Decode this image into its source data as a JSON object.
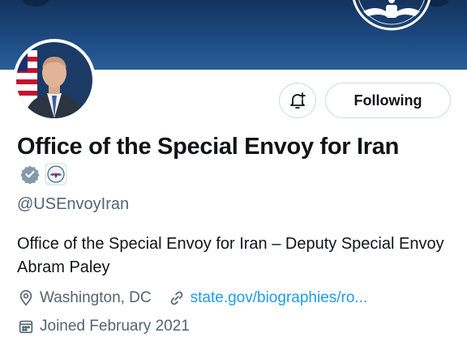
{
  "profile": {
    "display_name": "Office of the Special Envoy for Iran",
    "handle": "@USEnvoyIran",
    "bio": "Office of the Special Envoy for Iran – Deputy Special Envoy Abram Paley",
    "location": "Washington, DC",
    "website": "state.gov/biographies/ro...",
    "joined": "Joined February 2021"
  },
  "actions": {
    "follow_label": "Following"
  },
  "icons": {
    "verified": "verified-badge-icon",
    "affiliation": "state-department-seal-icon",
    "notifications": "bell-plus-icon",
    "location": "location-pin-icon",
    "link": "link-icon",
    "calendar": "calendar-icon"
  },
  "colors": {
    "banner": "#1d4a80",
    "link": "#1d9bf0",
    "secondary_text": "#536471",
    "verified_gray": "#829aab"
  }
}
